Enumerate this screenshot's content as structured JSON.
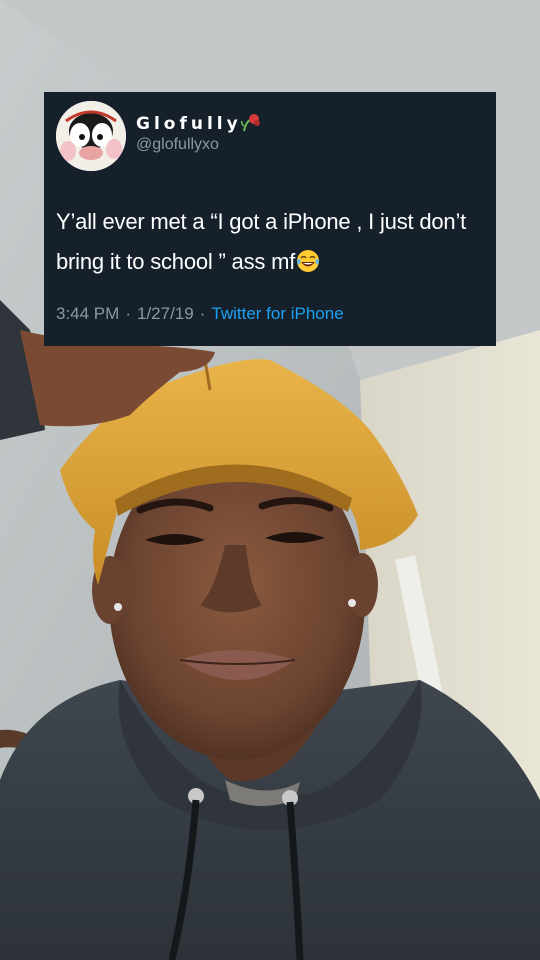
{
  "tweet": {
    "display_name": "Glofully",
    "handle": "@glofullyxo",
    "text": "Y’all ever met a “I got a iPhone , I just don’t bring it to school ” ass mf",
    "time": "3:44 PM",
    "separator": "·",
    "date": "1/27/19",
    "source": "Twitter for iPhone",
    "name_icon": "wilted-flower-icon",
    "text_icon": "face-with-tears-of-joy-icon"
  },
  "colors": {
    "card_background": "#15202b",
    "secondary_text": "#8899a6",
    "link": "#1da1f2",
    "durag": "#d9a23a",
    "hoodie": "#3a4149"
  }
}
